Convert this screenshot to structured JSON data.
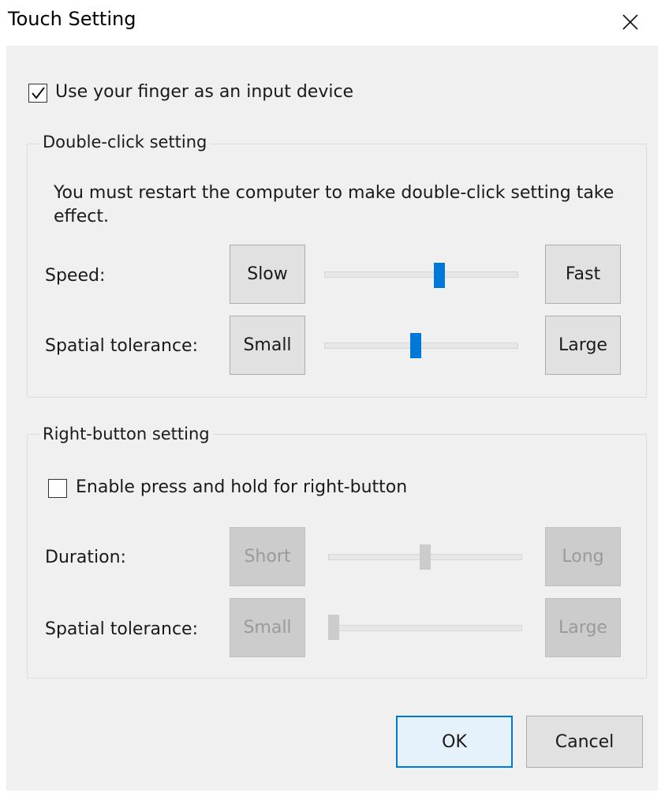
{
  "window": {
    "title": "Touch Setting",
    "close_icon": "close-icon"
  },
  "use_finger": {
    "label": "Use your finger as an input device",
    "checked": true
  },
  "double_click": {
    "legend": "Double-click setting",
    "note": "You must restart the computer to make double-click setting take effect.",
    "speed": {
      "label": "Speed:",
      "min_label": "Slow",
      "max_label": "Fast",
      "level": 0.6
    },
    "tolerance": {
      "label": "Spatial tolerance:",
      "min_label": "Small",
      "max_label": "Large",
      "level": 0.47
    }
  },
  "right_button": {
    "legend": "Right-button setting",
    "enable_label": "Enable press and hold for right-button",
    "enabled": false,
    "duration": {
      "label": "Duration:",
      "min_label": "Short",
      "max_label": "Long",
      "level": 0.5
    },
    "tolerance": {
      "label": "Spatial tolerance:",
      "min_label": "Small",
      "max_label": "Large",
      "level": 0.0
    }
  },
  "footer": {
    "ok_label": "OK",
    "cancel_label": "Cancel"
  },
  "colors": {
    "accent": "#0078d7",
    "window_bg": "#f0f0f0",
    "disabled_text": "#9a9a9a"
  }
}
